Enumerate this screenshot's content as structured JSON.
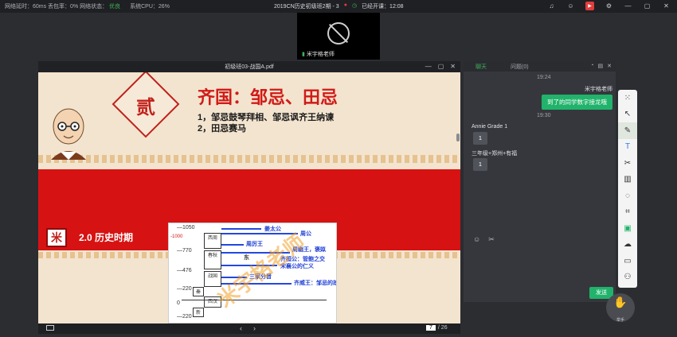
{
  "topbar": {
    "latency": "网络延时：60ms 丢包率：0% 网络状态：",
    "net_status": "优良",
    "cpu": "系统CPU：26%",
    "course_title": "2019CN历史初级班2期 - 3",
    "class_time": "已经开课：12:08",
    "icons": [
      "bell-icon",
      "user-icon",
      "record-icon",
      "gear-icon",
      "minimize-icon",
      "maximize-icon",
      "close-icon"
    ]
  },
  "video": {
    "teacher_name": "米宇格老师"
  },
  "document": {
    "filename": "初级班03-战国A.pdf",
    "slide": {
      "section_number": "贰",
      "title": "齐国：邹忌、田忌",
      "line1": "1，邹忌鼓琴拜相、邹忌讽齐王纳谏",
      "line2": "2，田忌赛马",
      "badge_char": "米",
      "section_title": "2.0 历史时期",
      "timeline": {
        "ticks": [
          "—1050",
          "-1000",
          "—770",
          "—476",
          "—220",
          "0",
          "—220"
        ],
        "states": [
          "西周",
          "春秋",
          "战国",
          "秦",
          "西汉",
          "新"
        ],
        "labels": [
          "姜太公",
          "周公",
          "周厉王",
          "周幽王，褒姒",
          "齐桓公：管鲍之交",
          "宋襄公的仁义",
          "三家分晋",
          "齐威王：邹忌的故事、田忌赛马",
          "东"
        ],
        "watermark": "米宇格老师"
      }
    },
    "page_current": "7",
    "page_total": "/ 26"
  },
  "chat": {
    "tab_chat": "聊天",
    "tab_questions": "问题(0)",
    "messages": [
      {
        "time": "19:24",
        "sender": "米宇格老师",
        "text": "到了的同学数字接龙哦",
        "self": true
      },
      {
        "time": "19:30",
        "sender": "Annie Grade 1",
        "text": "1",
        "self": false
      },
      {
        "time": "",
        "sender": "三年级+郑州+有福",
        "text": "1",
        "self": false
      }
    ],
    "send_label": "发送"
  },
  "tools": [
    "laser-pointer-icon",
    "select-icon",
    "pen-icon",
    "text-icon",
    "scissors-icon",
    "trash-icon",
    "eraser-icon",
    "chart-icon",
    "chat-bubble-icon",
    "cloud-icon",
    "toolbox-icon",
    "group-icon"
  ],
  "hand_label": "举手"
}
